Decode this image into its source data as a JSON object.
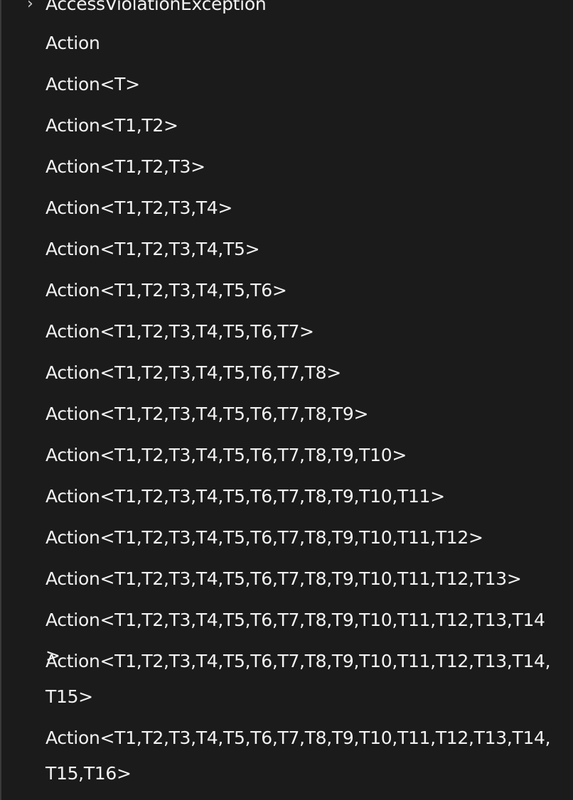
{
  "tree": {
    "collapsed_parent": "AccessViolationException",
    "items": [
      "Action",
      "Action<T>",
      "Action<T1,T2>",
      "Action<T1,T2,T3>",
      "Action<T1,T2,T3,T4>",
      "Action<T1,T2,T3,T4,T5>",
      "Action<T1,T2,T3,T4,T5,T6>",
      "Action<T1,T2,T3,T4,T5,T6,T7>",
      "Action<T1,T2,T3,T4,T5,T6,T7,T8>",
      "Action<T1,T2,T3,T4,T5,T6,T7,T8,T9>",
      "Action<T1,T2,T3,T4,T5,T6,T7,T8,T9,T10>",
      "Action<T1,T2,T3,T4,T5,T6,T7,T8,T9,T10,T11>",
      "Action<T1,T2,T3,T4,T5,T6,T7,T8,T9,T10,T11,T12>",
      "Action<T1,T2,T3,T4,T5,T6,T7,T8,T9,T10,T11,T12,T13>",
      "Action<T1,T2,T3,T4,T5,T6,T7,T8,T9,T10,T11,T12,T13,T14>",
      "Action<T1,T2,T3,T4,T5,T6,T7,T8,T9,T10,T11,T12,T13,T14,T15>",
      "Action<T1,T2,T3,T4,T5,T6,T7,T8,T9,T10,T11,T12,T13,T14,T15,T16>"
    ],
    "chevron_icon": "chevron-right-icon"
  }
}
